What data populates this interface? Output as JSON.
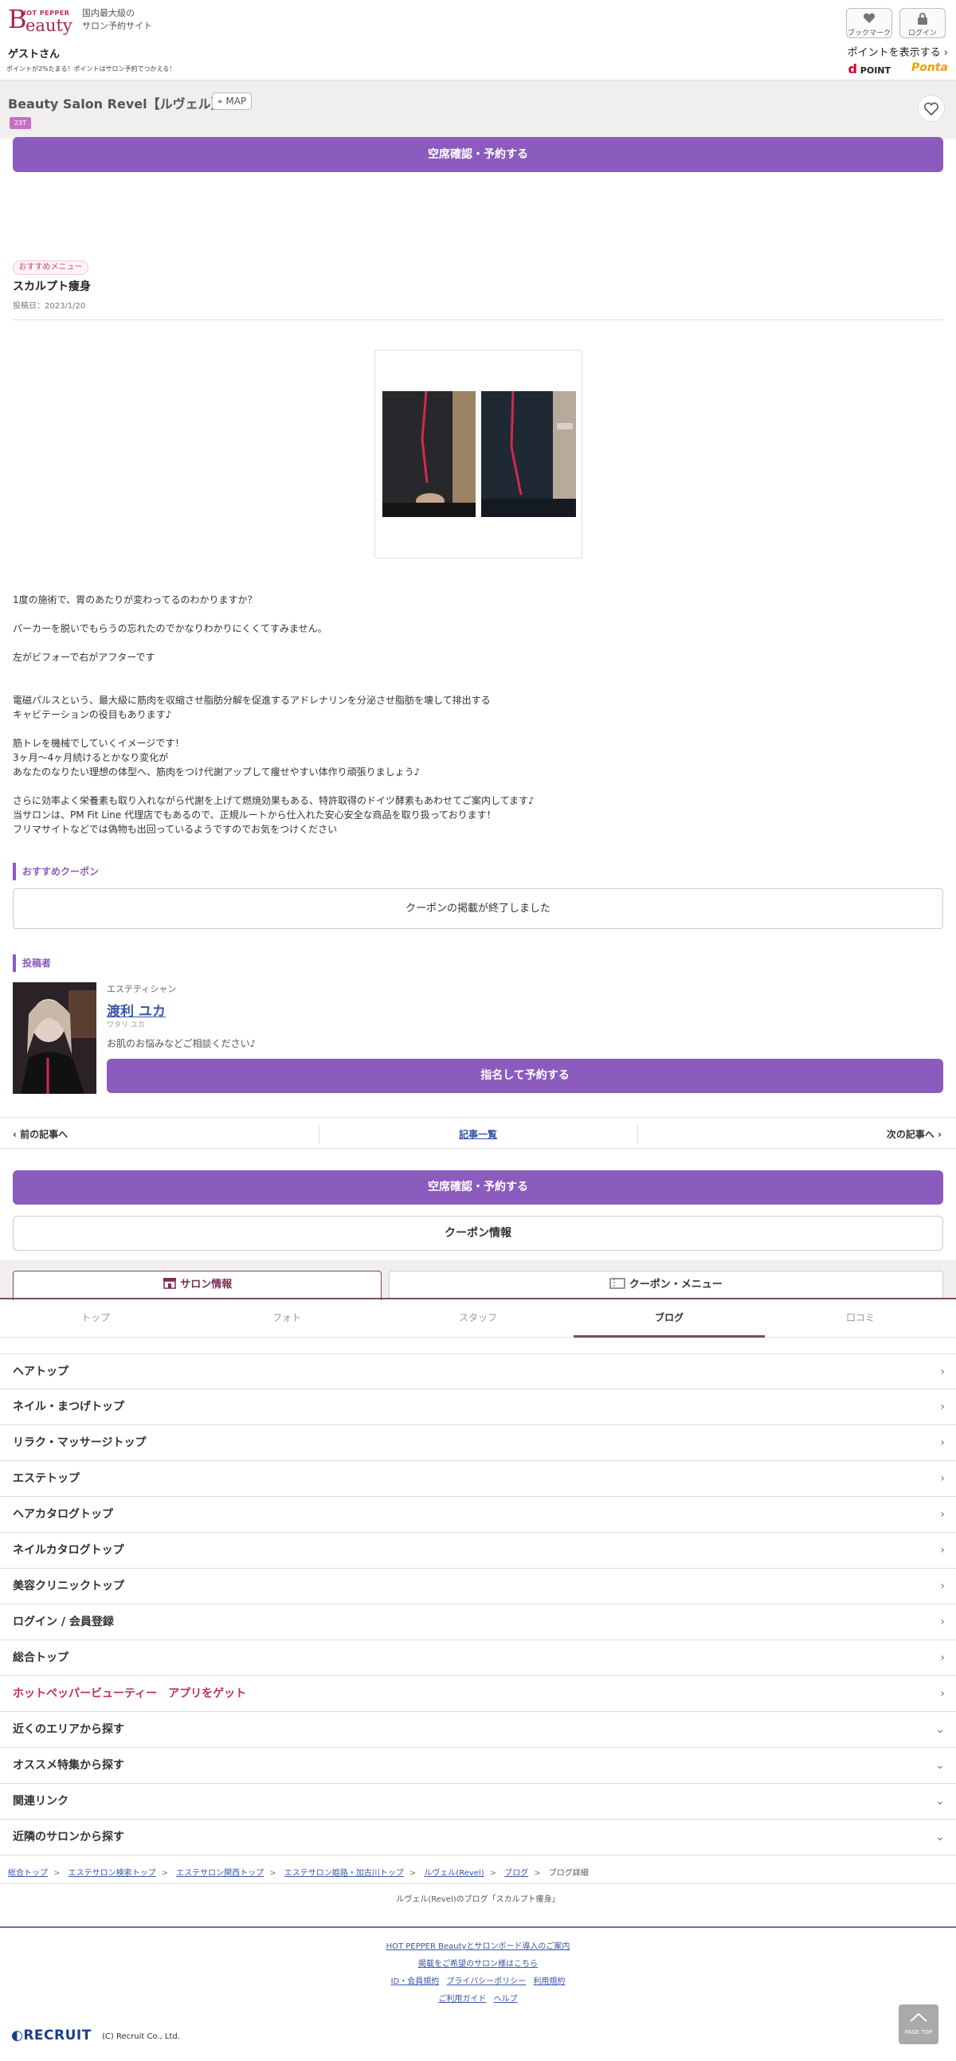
{
  "header": {
    "brand_small": "HOT PEPPER",
    "brand_b": "B",
    "brand_rest": "eauty",
    "catch1": "国内最大級の",
    "catch2": "サロン予約サイト",
    "bookmark": "ブックマーク",
    "login": "ログイン",
    "guest": "ゲストさん",
    "point_msg": "ポイントが2%たまる！ポイントはサロン予約でつかえる！",
    "show_points": "ポイントを表示する",
    "dpoint": "POINT",
    "ponta": "Ponta"
  },
  "salon": {
    "name": "Beauty Salon Revel【ルヴェル】",
    "map": "MAP",
    "badge": "23T",
    "reserve": "空席確認・予約する"
  },
  "article": {
    "tag": "おすすめメニュー",
    "title": "スカルプト痩身",
    "date": "投稿日：2023/1/20",
    "lines": [
      "1度の施術で、胃のあたりが変わってるのわかりますか？",
      "パーカーを脱いでもらうの忘れたのでかなりわかりにくくてすみません。",
      "左がビフォーで右がアフターです",
      "電磁パルスという、最大級に筋肉を収縮させ脂肪分解を促進するアドレナリンを分泌させ脂肪を壊して排出する",
      "キャビテーションの役目もあります♪",
      "筋トレを機械でしていくイメージです！",
      "3ヶ月〜4ヶ月続けるとかなり変化が",
      "あなたのなりたい理想の体型へ、筋肉をつけ代謝アップして痩せやすい体作り頑張りましょう♪",
      "さらに効率よく栄養素も取り入れながら代謝を上げて燃焼効果もある、特許取得のドイツ酵素もあわせてご案内してます♪",
      "当サロンは、PM Fit Line 代理店でもあるので、正規ルートから仕入れた安心安全な商品を取り扱っております！",
      "フリマサイトなどでは偽物も出回っているようですのでお気をつけください"
    ]
  },
  "coupon": {
    "heading": "おすすめクーポン",
    "ended": "クーポンの掲載が終了しました"
  },
  "poster": {
    "heading": "投稿者",
    "position": "エステティシャン",
    "name": "渡利 ユカ",
    "kana": "ワタリ ユカ",
    "message": "お肌のお悩みなどご相談ください♪",
    "nominate": "指名して予約する"
  },
  "pager": {
    "prev": "前の記事へ",
    "list": "記事一覧",
    "next": "次の記事へ"
  },
  "bottom": {
    "reserve": "空席確認・予約する",
    "coupon_info": "クーポン情報"
  },
  "tabs": {
    "salon": "サロン情報",
    "coupon": "クーポン・メニュー"
  },
  "subtabs": [
    "トップ",
    "フォト",
    "スタッフ",
    "ブログ",
    "口コミ"
  ],
  "nav": [
    "ヘアトップ",
    "ネイル・まつげトップ",
    "リラク・マッサージトップ",
    "エステトップ",
    "ヘアカタログトップ",
    "ネイルカタログトップ",
    "美容クリニックトップ",
    "ログイン / 会員登録",
    "総合トップ",
    "ホットペッパービューティー　アプリをゲット",
    "近くのエリアから探す",
    "オススメ特集から探す",
    "関連リンク",
    "近隣のサロンから探す"
  ],
  "breadcrumb": [
    "総合トップ",
    "エステサロン検索トップ",
    "エステサロン関西トップ",
    "エステサロン姫路・加古川トップ",
    "ルヴェル(Revel)",
    "ブログ",
    "ブログ詳細"
  ],
  "blog_caption": "ルヴェル(Revel)のブログ「スカルプト痩身」",
  "footer": {
    "l1": "HOT PEPPER Beautyとサロンボード導入のご案内",
    "l2": "掲載をご希望のサロン様はこちら",
    "l3a": "ID・会員規約",
    "l3b": "プライバシーポリシー",
    "l3c": "利用規約",
    "l4a": "ご利用ガイド",
    "l4b": "ヘルプ",
    "recruit": "RECRUIT",
    "copyright": "(C) Recruit Co., Ltd.",
    "pagetop": "PAGE TOP"
  },
  "colors": {
    "accent": "#8b5cbd",
    "brand": "#a3274a"
  }
}
